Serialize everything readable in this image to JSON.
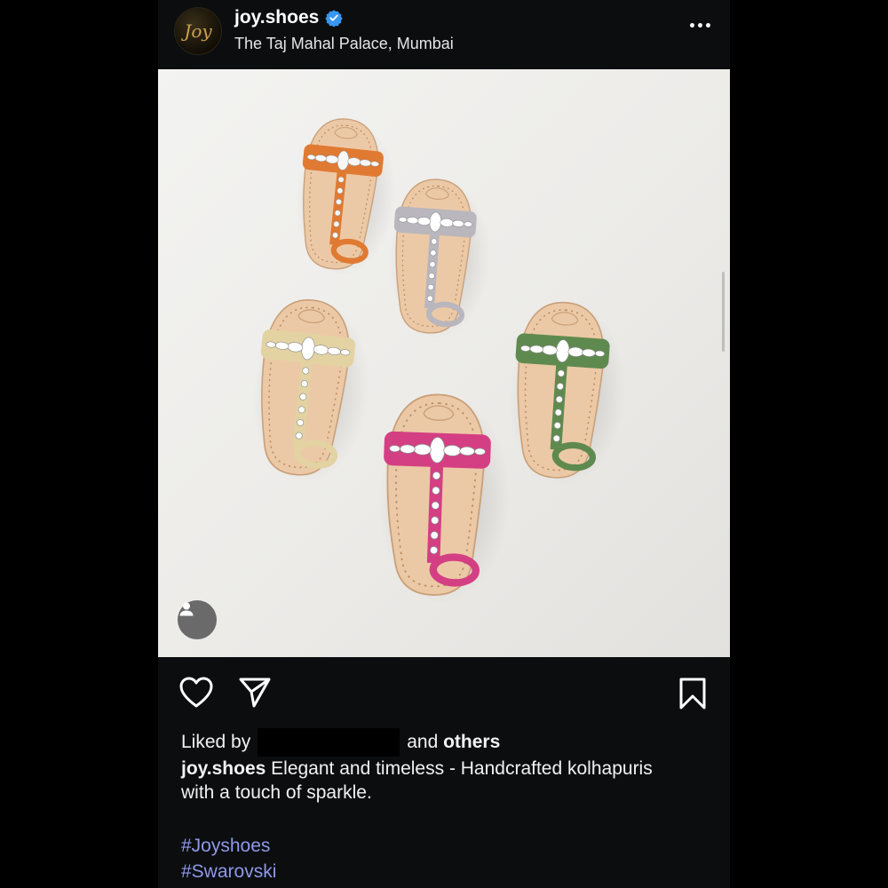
{
  "post": {
    "account": {
      "avatar_text": "Joy",
      "username": "joy.shoes",
      "verified": true,
      "location": "The Taj Mahal Palace, Mumbai"
    },
    "image": {
      "subject": "Five jewelled kolhapuri sandals",
      "sandal_colors": [
        "#e07a32",
        "#b9b6bd",
        "#e3d2a2",
        "#d43f84",
        "#5f8a4f"
      ],
      "sole_color": "#e7c5a2"
    },
    "actions": {
      "like": "heart-icon",
      "share": "paper-plane-icon",
      "save": "bookmark-icon"
    },
    "likes": {
      "prefix": "Liked by",
      "suffix_and": "and",
      "suffix_others": "others"
    },
    "caption": {
      "username": "joy.shoes",
      "text": "Elegant and timeless - Handcrafted kolhapuris with a touch of sparkle."
    },
    "hashtags": [
      "#Joyshoes",
      "#Swarovski"
    ]
  }
}
